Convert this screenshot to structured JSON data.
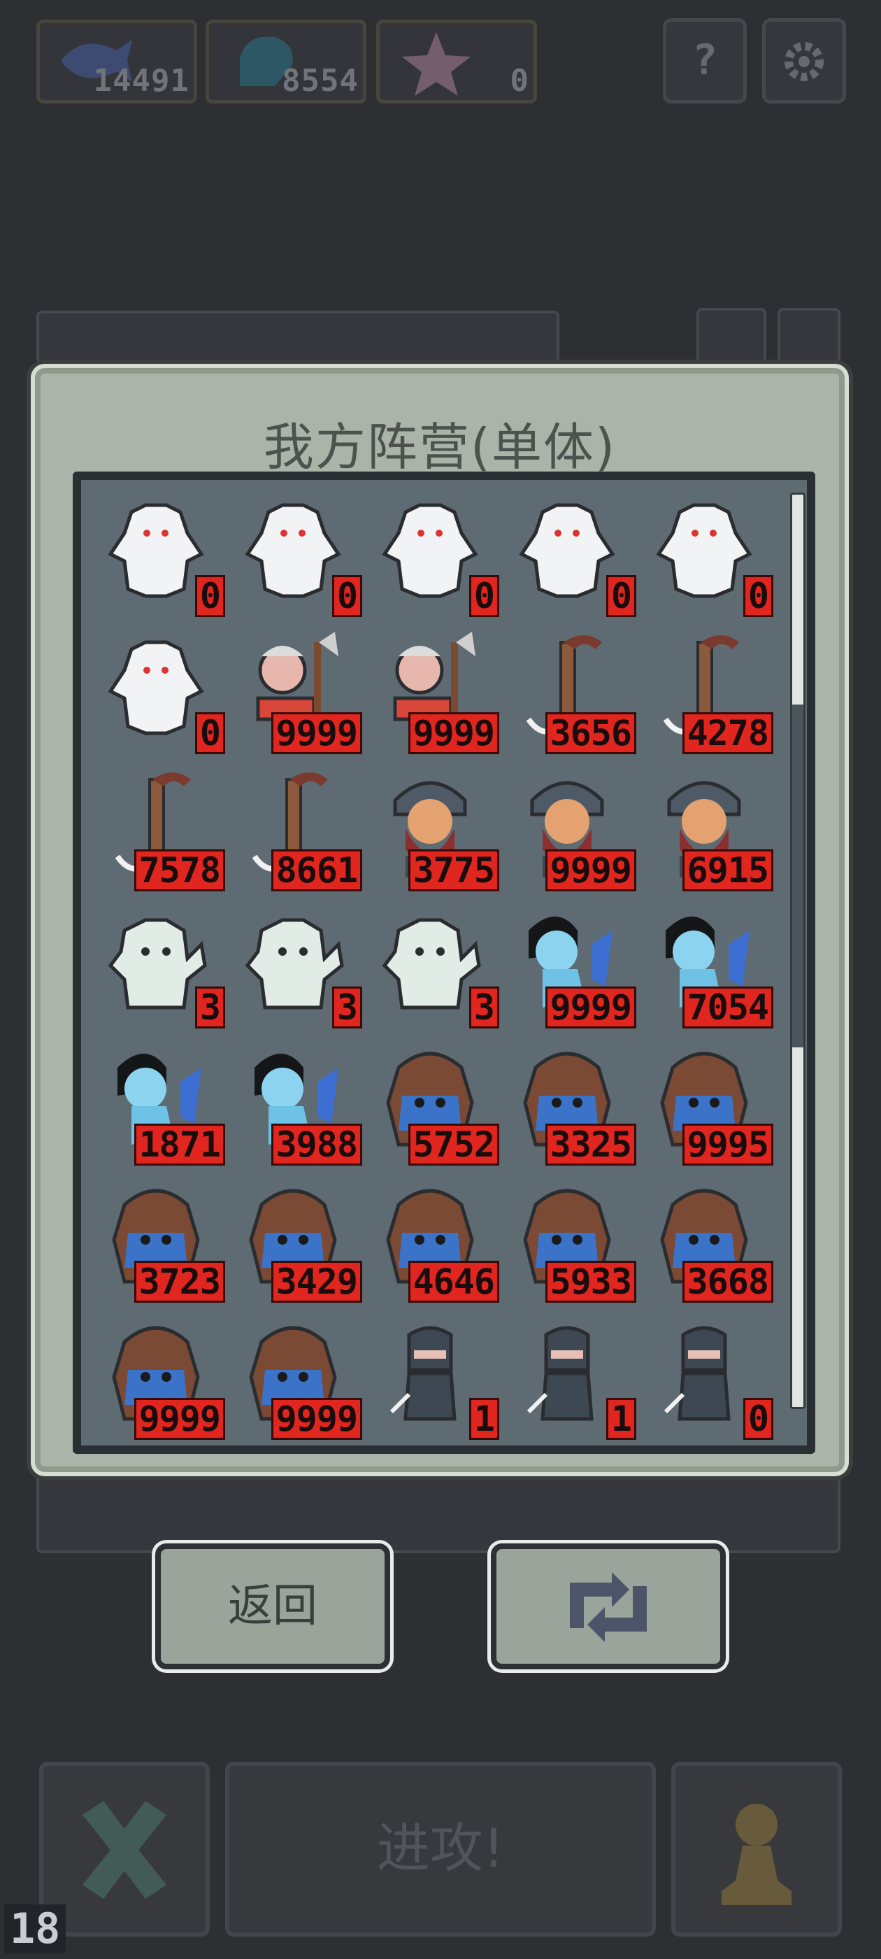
{
  "resources": [
    {
      "icon": "fish-icon",
      "value": "14491"
    },
    {
      "icon": "gem-icon",
      "value": "8554"
    },
    {
      "icon": "star-icon",
      "value": "0"
    }
  ],
  "top_buttons": {
    "help": "?",
    "settings_icon": "gear-icon"
  },
  "modal": {
    "title": "我方阵营(单体)",
    "units": [
      {
        "type": "yeti",
        "count": "0"
      },
      {
        "type": "yeti",
        "count": "0"
      },
      {
        "type": "yeti",
        "count": "0"
      },
      {
        "type": "yeti",
        "count": "0"
      },
      {
        "type": "yeti",
        "count": "0"
      },
      {
        "type": "yeti",
        "count": "0"
      },
      {
        "type": "elder",
        "count": "9999"
      },
      {
        "type": "elder",
        "count": "9999"
      },
      {
        "type": "staff",
        "count": "3656"
      },
      {
        "type": "staff",
        "count": "4278"
      },
      {
        "type": "staff",
        "count": "7578"
      },
      {
        "type": "staff",
        "count": "8661"
      },
      {
        "type": "viking",
        "count": "3775"
      },
      {
        "type": "viking",
        "count": "9999"
      },
      {
        "type": "viking",
        "count": "6915"
      },
      {
        "type": "ghost",
        "count": "3"
      },
      {
        "type": "ghost",
        "count": "3"
      },
      {
        "type": "ghost",
        "count": "3"
      },
      {
        "type": "mermaid",
        "count": "9999"
      },
      {
        "type": "mermaid",
        "count": "7054"
      },
      {
        "type": "mermaid",
        "count": "1871"
      },
      {
        "type": "mermaid",
        "count": "3988"
      },
      {
        "type": "ogre",
        "count": "5752"
      },
      {
        "type": "ogre",
        "count": "3325"
      },
      {
        "type": "ogre",
        "count": "9995"
      },
      {
        "type": "ogre",
        "count": "3723"
      },
      {
        "type": "ogre",
        "count": "3429"
      },
      {
        "type": "ogre",
        "count": "4646"
      },
      {
        "type": "ogre",
        "count": "5933"
      },
      {
        "type": "ogre",
        "count": "3668"
      },
      {
        "type": "ogre",
        "count": "9999"
      },
      {
        "type": "ogre",
        "count": "9999"
      },
      {
        "type": "ninja",
        "count": "1"
      },
      {
        "type": "ninja",
        "count": "1"
      },
      {
        "type": "ninja",
        "count": "0"
      }
    ]
  },
  "buttons": {
    "back": "返回",
    "refresh_icon": "swap-arrows-icon"
  },
  "bottom_bar": {
    "cancel_icon": "x-icon",
    "attack": "进攻!",
    "pawn_icon": "pawn-icon",
    "level": "18"
  },
  "colors": {
    "count_badge": "#e0261f",
    "panel": "#5e6b72",
    "modal": "#aab4a8"
  }
}
